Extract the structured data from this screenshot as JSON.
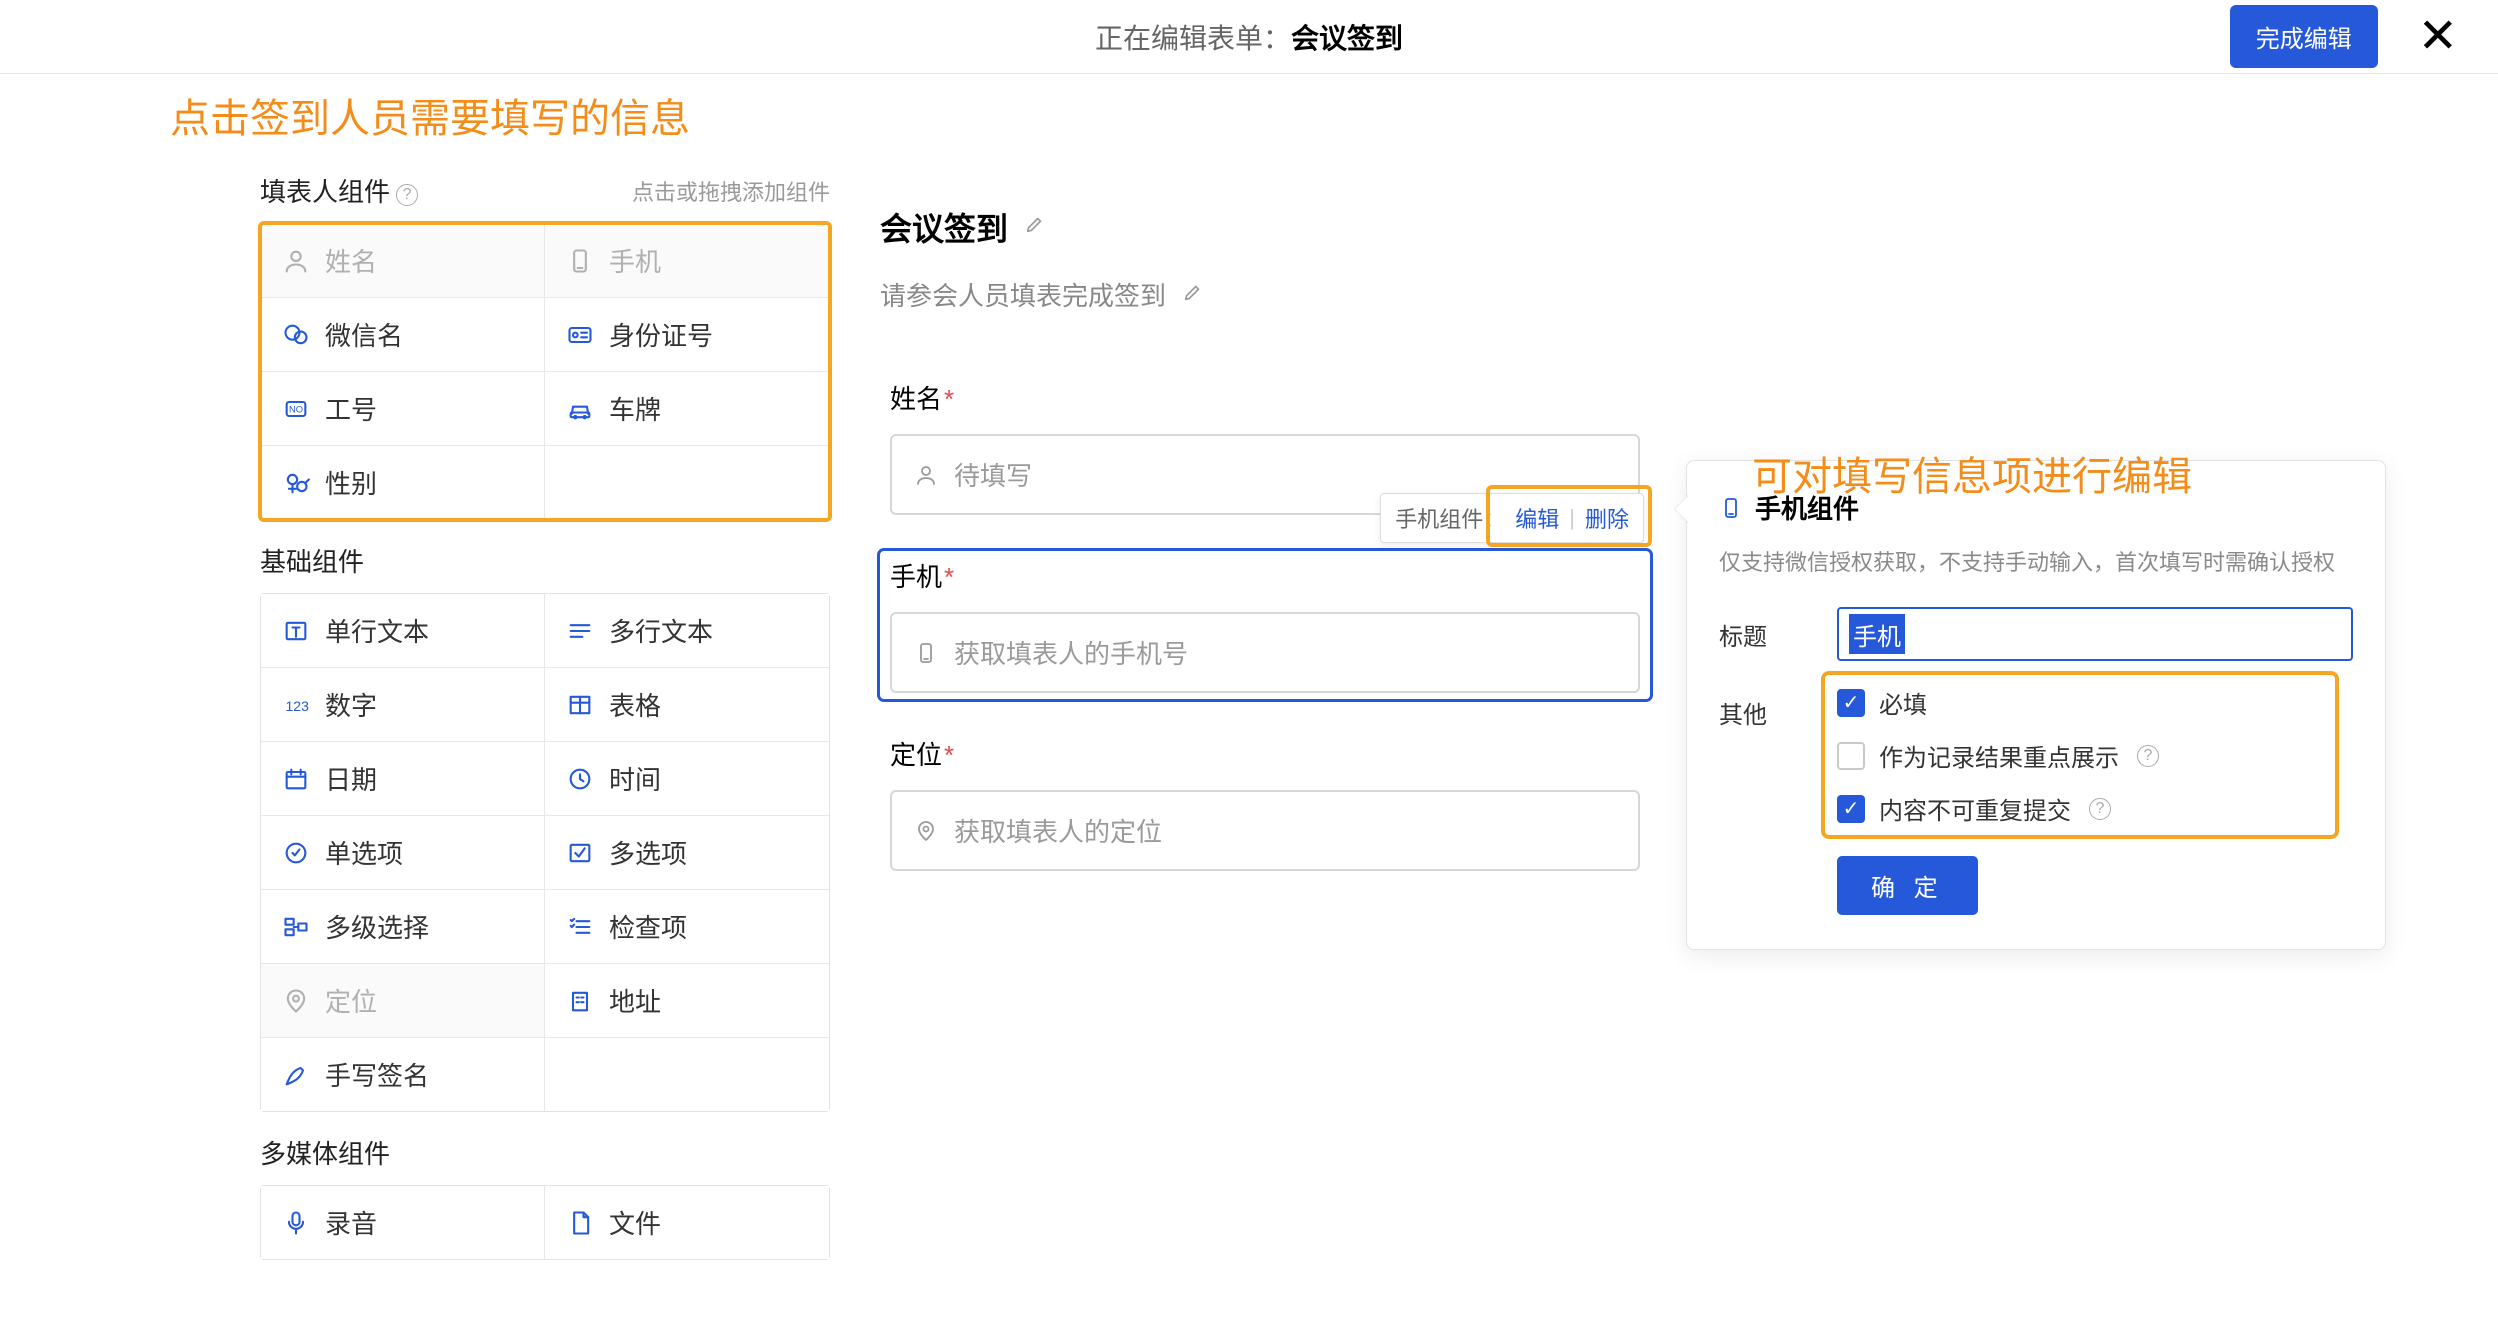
{
  "header": {
    "editing_prefix": "正在编辑表单：",
    "form_name": "会议签到",
    "done_label": "完成编辑"
  },
  "annotations": {
    "left_hint": "点击签到人员需要填写的信息",
    "right_hint": "可对填写信息项进行编辑"
  },
  "sidebar": {
    "sections": {
      "filler": {
        "title": "填表人组件",
        "hint": "点击或拖拽添加组件",
        "items": [
          {
            "label": "姓名",
            "disabled": true
          },
          {
            "label": "手机",
            "disabled": true
          },
          {
            "label": "微信名",
            "disabled": false
          },
          {
            "label": "身份证号",
            "disabled": false
          },
          {
            "label": "工号",
            "disabled": false
          },
          {
            "label": "车牌",
            "disabled": false
          },
          {
            "label": "性别",
            "disabled": false
          },
          {
            "label": "",
            "disabled": false
          }
        ]
      },
      "basic": {
        "title": "基础组件",
        "items": [
          {
            "label": "单行文本"
          },
          {
            "label": "多行文本"
          },
          {
            "label": "数字"
          },
          {
            "label": "表格"
          },
          {
            "label": "日期"
          },
          {
            "label": "时间"
          },
          {
            "label": "单选项"
          },
          {
            "label": "多选项"
          },
          {
            "label": "多级选择"
          },
          {
            "label": "检查项"
          },
          {
            "label": "定位",
            "disabled": true
          },
          {
            "label": "地址"
          },
          {
            "label": "手写签名"
          },
          {
            "label": ""
          }
        ]
      },
      "media": {
        "title": "多媒体组件",
        "items": [
          {
            "label": "录音"
          },
          {
            "label": "文件"
          }
        ]
      }
    }
  },
  "canvas": {
    "title": "会议签到",
    "description": "请参会人员填表完成签到",
    "fields": {
      "name": {
        "label": "姓名",
        "placeholder": "待填写"
      },
      "phone": {
        "label": "手机",
        "placeholder": "获取填表人的手机号"
      },
      "location": {
        "label": "定位",
        "placeholder": "获取填表人的定位"
      }
    },
    "popover": {
      "prefix": "手机组件：",
      "edit": "编辑",
      "delete": "删除"
    }
  },
  "editor": {
    "title": "手机组件",
    "note": "仅支持微信授权获取，不支持手动输入，首次填写时需确认授权",
    "row_title_label": "标题",
    "title_value": "手机",
    "row_other_label": "其他",
    "options": {
      "required": "必填",
      "highlight": "作为记录结果重点展示",
      "unique": "内容不可重复提交"
    },
    "confirm": "确 定"
  }
}
